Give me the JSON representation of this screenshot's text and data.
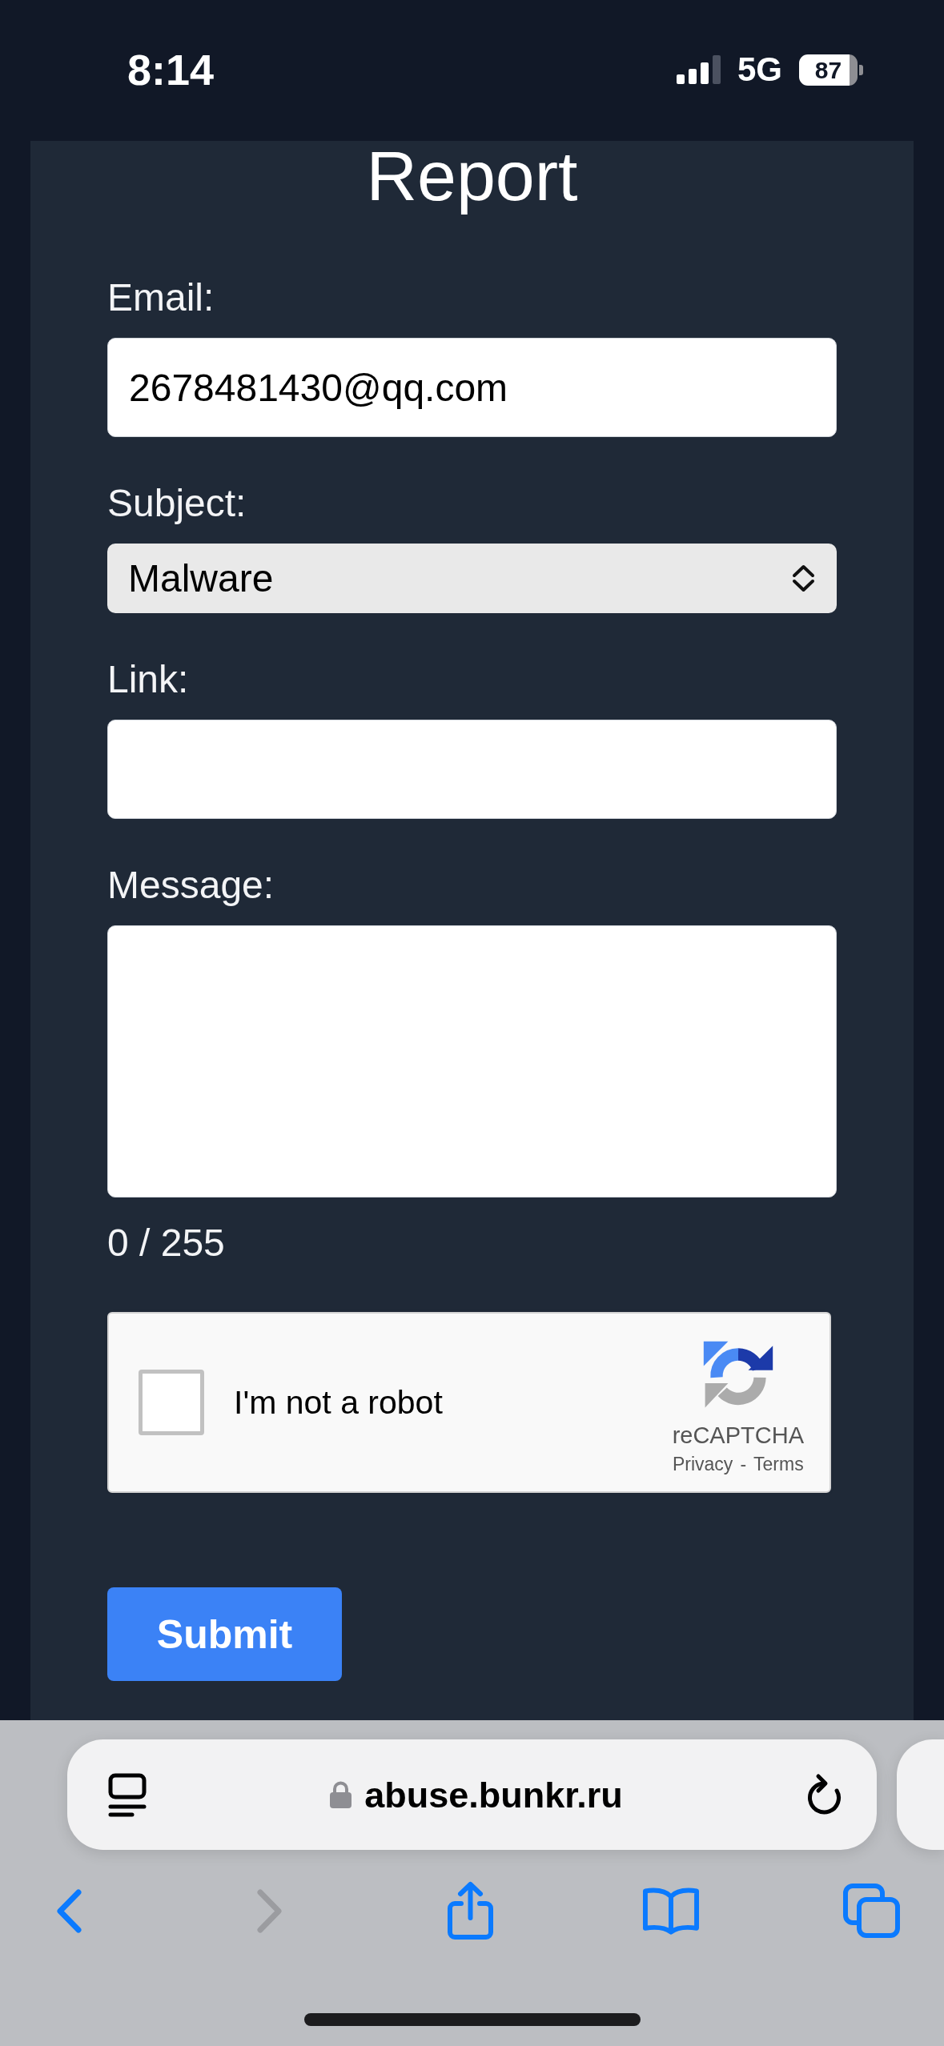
{
  "status_bar": {
    "time": "8:14",
    "network": "5G",
    "battery": "87"
  },
  "page": {
    "title": "Report",
    "fields": [
      {
        "kind": "text",
        "label": "Email:",
        "value": "2678481430@qq.com"
      },
      {
        "kind": "select",
        "label": "Subject:",
        "value": "Malware"
      },
      {
        "kind": "text",
        "label": "Link:"
      },
      {
        "kind": "textarea",
        "label": "Message:"
      }
    ],
    "counter": "0 / 255",
    "captcha": {
      "checked": false,
      "label": "I'm not a robot",
      "brand": "reCAPTCHA",
      "links": [
        "Privacy",
        "Terms"
      ],
      "separator": "-"
    },
    "submit": "Submit"
  },
  "browser": {
    "url": "abuse.bunkr.ru",
    "toolbar": [
      {
        "kind": "back",
        "disabled": false
      },
      {
        "kind": "forward",
        "disabled": true
      },
      {
        "kind": "share",
        "disabled": false
      },
      {
        "kind": "bookmarks",
        "disabled": false
      },
      {
        "kind": "tabs",
        "disabled": false
      }
    ]
  }
}
